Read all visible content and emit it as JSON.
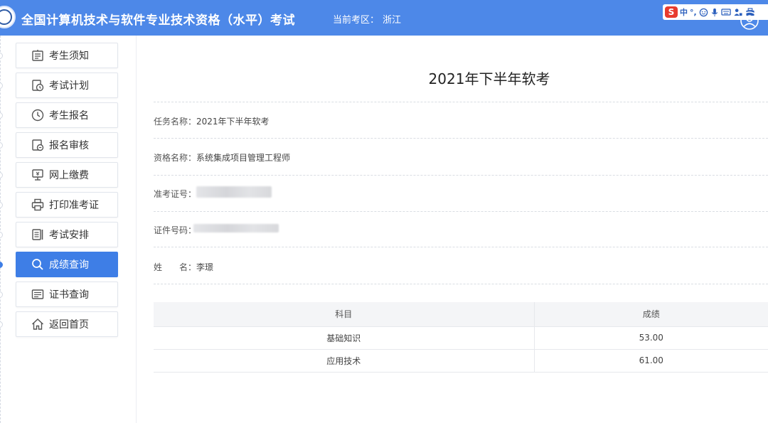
{
  "header": {
    "title": "全国计算机技术与软件专业技术资格（水平）考试",
    "region_label": "当前考区：",
    "region_value": "浙江",
    "ime": {
      "logo": "S",
      "mode": "中",
      "punct": "°,"
    }
  },
  "sidebar": {
    "items": [
      {
        "label": "考生须知",
        "icon": "notice-icon"
      },
      {
        "label": "考试计划",
        "icon": "schedule-icon"
      },
      {
        "label": "考生报名",
        "icon": "clock-icon"
      },
      {
        "label": "报名审核",
        "icon": "review-icon"
      },
      {
        "label": "网上缴费",
        "icon": "payment-icon"
      },
      {
        "label": "打印准考证",
        "icon": "printer-icon"
      },
      {
        "label": "考试安排",
        "icon": "arrangement-icon"
      },
      {
        "label": "成绩查询",
        "icon": "search-icon",
        "active": true
      },
      {
        "label": "证书查询",
        "icon": "certificate-icon"
      },
      {
        "label": "返回首页",
        "icon": "home-icon"
      }
    ]
  },
  "main": {
    "title": "2021年下半年软考",
    "task_label": "任务名称：",
    "task_value": "2021年下半年软考",
    "qual_label": "资格名称：",
    "qual_value": "系统集成项目管理工程师",
    "ticket_label": "准考证号：",
    "id_label": "证件号码：",
    "name_label": "姓　　名：",
    "name_value": "李璟"
  },
  "scores": {
    "headers": [
      "科目",
      "成绩"
    ],
    "rows": [
      {
        "subject": "基础知识",
        "score": "53.00"
      },
      {
        "subject": "应用技术",
        "score": "61.00"
      }
    ]
  },
  "colors": {
    "header_bg": "#4d88e8",
    "active_nav": "#3e7ee6"
  }
}
